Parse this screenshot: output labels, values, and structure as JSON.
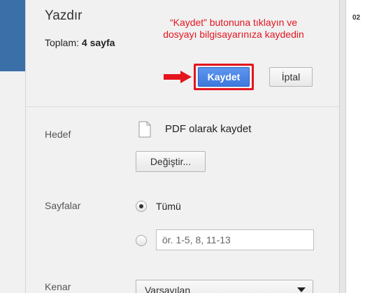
{
  "print": {
    "title": "Yazdır",
    "total_label": "Toplam:",
    "total_value": "4 sayfa",
    "save_label": "Kaydet",
    "cancel_label": "İptal"
  },
  "annotation": {
    "text": "“Kaydet” butonuna tıklayın ve dosyayı bilgisayarınıza kaydedin",
    "color": "#e4151f"
  },
  "destination": {
    "label": "Hedef",
    "value": "PDF olarak kaydet",
    "change_label": "Değiştir...",
    "icon": "document-icon"
  },
  "pages": {
    "label": "Sayfalar",
    "all_label": "Tümü",
    "all_selected": true,
    "custom_placeholder": "ör. 1-5, 8, 11-13"
  },
  "margins": {
    "label": "Kenar",
    "value": "Varsayılan"
  },
  "preview": {
    "text": "02"
  },
  "colors": {
    "primary_button": "#4a86e8",
    "highlight": "#e4151f",
    "panel_bg": "#f1f1f1",
    "sidebar_accent": "#3b6fa8"
  }
}
